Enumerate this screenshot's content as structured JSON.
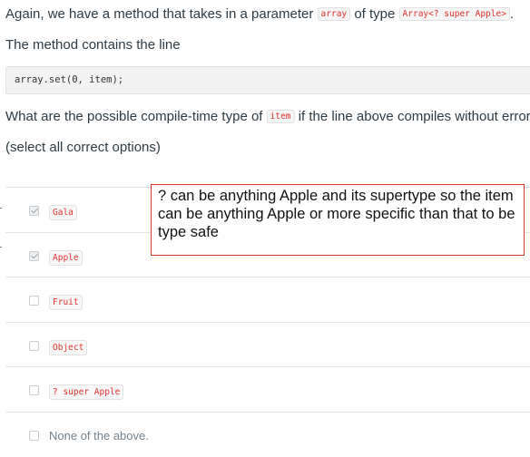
{
  "question": {
    "line1_a": "Again, we have a method that takes in a parameter",
    "line1_code1": "array",
    "line1_b": "of type",
    "line1_code2": "Array<? super Apple>",
    "line1_c": ".",
    "line2": "The method contains the line",
    "code_block": "array.set(0, item);",
    "line3_a": "What are the possible compile-time type of",
    "line3_code": "item",
    "line3_b": "if the line above compiles without error?",
    "line4": "(select all correct options)"
  },
  "options": [
    {
      "label": "Gala",
      "checked": true,
      "code": true
    },
    {
      "label": "Apple",
      "checked": true,
      "code": true
    },
    {
      "label": "Fruit",
      "checked": false,
      "code": true
    },
    {
      "label": "Object",
      "checked": false,
      "code": true
    },
    {
      "label": "? super Apple",
      "checked": false,
      "code": true
    },
    {
      "label": "None of the above.",
      "checked": false,
      "code": false
    }
  ],
  "annotation": {
    "text": "? can be anything Apple and its supertype so the item can be anything Apple or more specific than that to be type safe",
    "border_color": "#d9342b"
  },
  "colors": {
    "code_text": "#e0322f",
    "body_text": "#2d3b45"
  }
}
